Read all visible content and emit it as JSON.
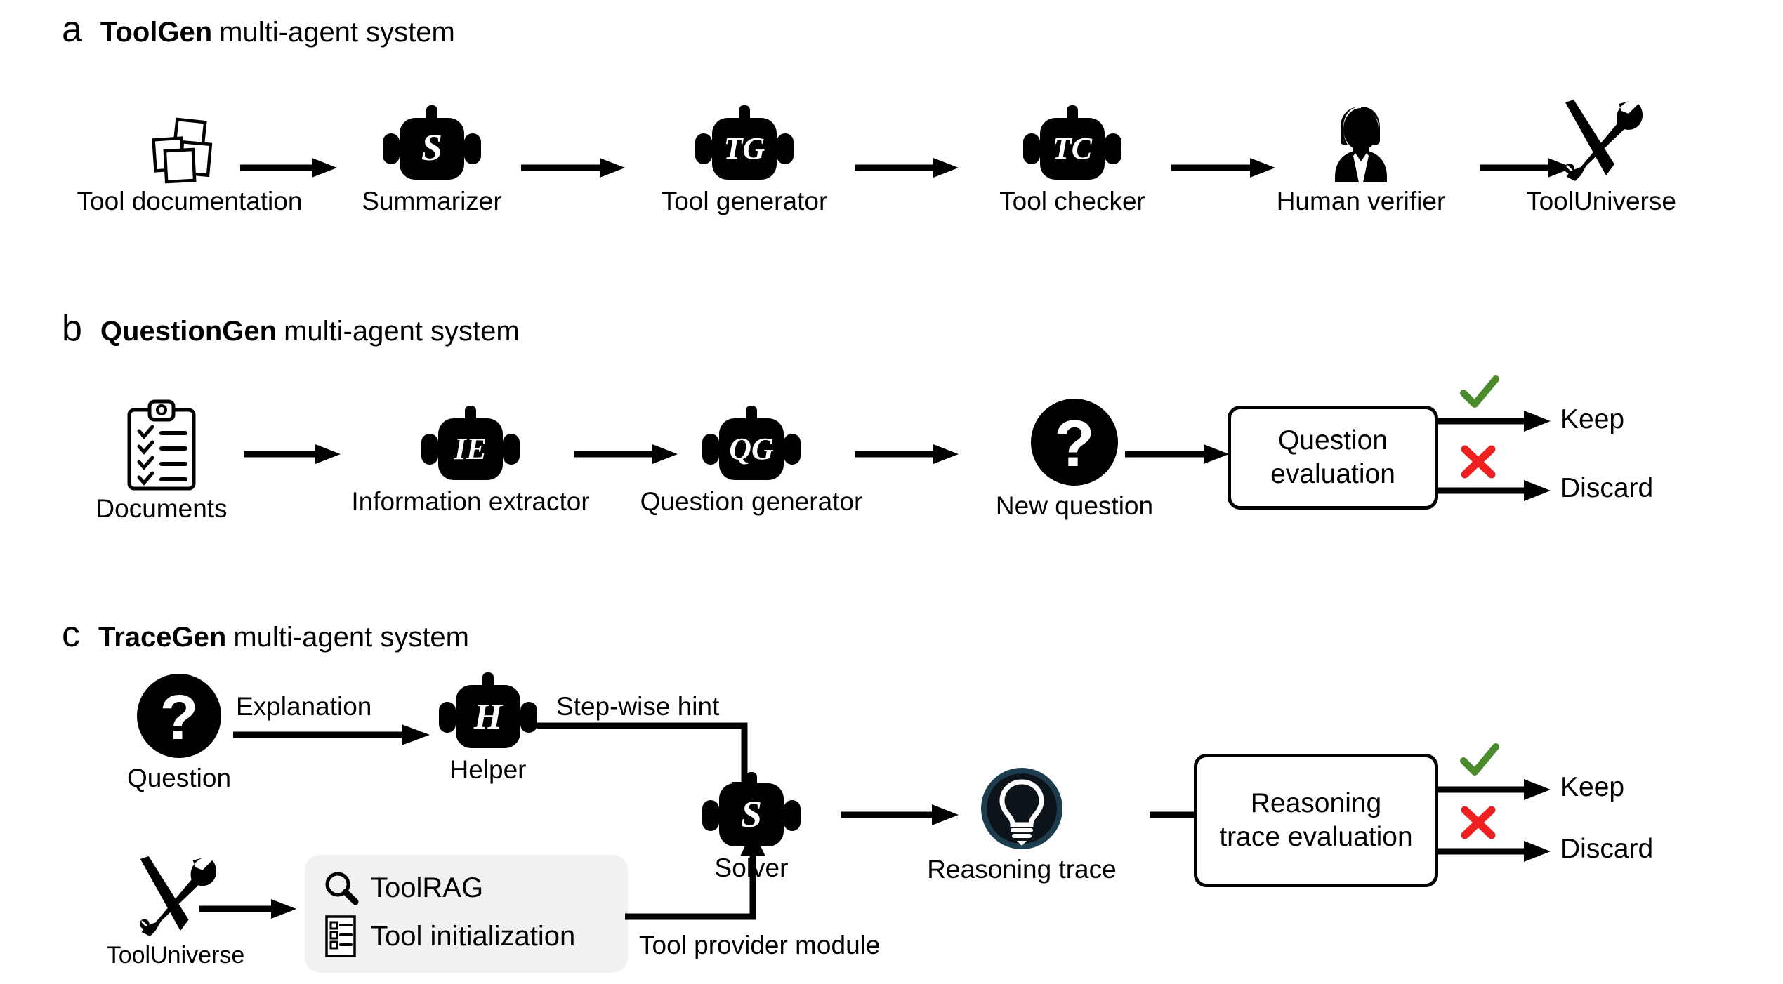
{
  "figure": {
    "panels": [
      {
        "letter": "a",
        "title_bold": "ToolGen",
        "title_rest": "multi-agent system",
        "nodes": [
          {
            "label": "Tool documentation",
            "icon": "documents-stack-icon",
            "badge": ""
          },
          {
            "label": "Summarizer",
            "icon": "robot-icon",
            "badge": "S"
          },
          {
            "label": "Tool generator",
            "icon": "robot-icon",
            "badge": "TG"
          },
          {
            "label": "Tool checker",
            "icon": "robot-icon",
            "badge": "TC"
          },
          {
            "label": "Human verifier",
            "icon": "person-icon",
            "badge": ""
          },
          {
            "label": "ToolUniverse",
            "icon": "wrench-screwdriver-icon",
            "badge": ""
          }
        ]
      },
      {
        "letter": "b",
        "title_bold": "QuestionGen",
        "title_rest": "multi-agent system",
        "nodes": [
          {
            "label": "Documents",
            "icon": "clipboard-checklist-icon",
            "badge": ""
          },
          {
            "label": "Information extractor",
            "icon": "robot-icon",
            "badge": "IE"
          },
          {
            "label": "Question generator",
            "icon": "robot-icon",
            "badge": "QG"
          },
          {
            "label": "New question",
            "icon": "question-circle-icon",
            "badge": "?"
          }
        ],
        "eval_box": {
          "line1": "Question",
          "line2": "evaluation"
        },
        "branches": [
          {
            "mark": "check",
            "label": "Keep"
          },
          {
            "mark": "cross",
            "label": "Discard"
          }
        ]
      },
      {
        "letter": "c",
        "title_bold": "TraceGen",
        "title_rest": "multi-agent system",
        "nodes": [
          {
            "label": "Question",
            "icon": "question-circle-icon",
            "badge": "?"
          },
          {
            "label": "Helper",
            "icon": "robot-icon",
            "badge": "H"
          },
          {
            "label": "Solver",
            "icon": "robot-icon",
            "badge": "S"
          },
          {
            "label": "Reasoning trace",
            "icon": "lightbulb-circle-icon",
            "badge": ""
          },
          {
            "label": "ToolUniverse",
            "icon": "wrench-screwdriver-icon",
            "badge": ""
          }
        ],
        "edge_labels": [
          {
            "text": "Explanation"
          },
          {
            "text": "Step-wise hint"
          }
        ],
        "tool_provider": {
          "rows": [
            {
              "icon": "magnifier-icon",
              "text": "ToolRAG"
            },
            {
              "icon": "list-icon",
              "text": "Tool initialization"
            }
          ],
          "caption": "Tool provider module"
        },
        "eval_box": {
          "line1": "Reasoning",
          "line2": "trace evaluation"
        },
        "branches": [
          {
            "mark": "check",
            "label": "Keep"
          },
          {
            "mark": "cross",
            "label": "Discard"
          }
        ]
      }
    ]
  },
  "colors": {
    "ink": "#000000",
    "background": "#ffffff",
    "check_green": "#4a8b2c",
    "cross_red": "#ee2020",
    "panel_grey": "#f1f1f1",
    "bulb_navy": "#0d1419",
    "bulb_ring": "#1d3c4e"
  }
}
